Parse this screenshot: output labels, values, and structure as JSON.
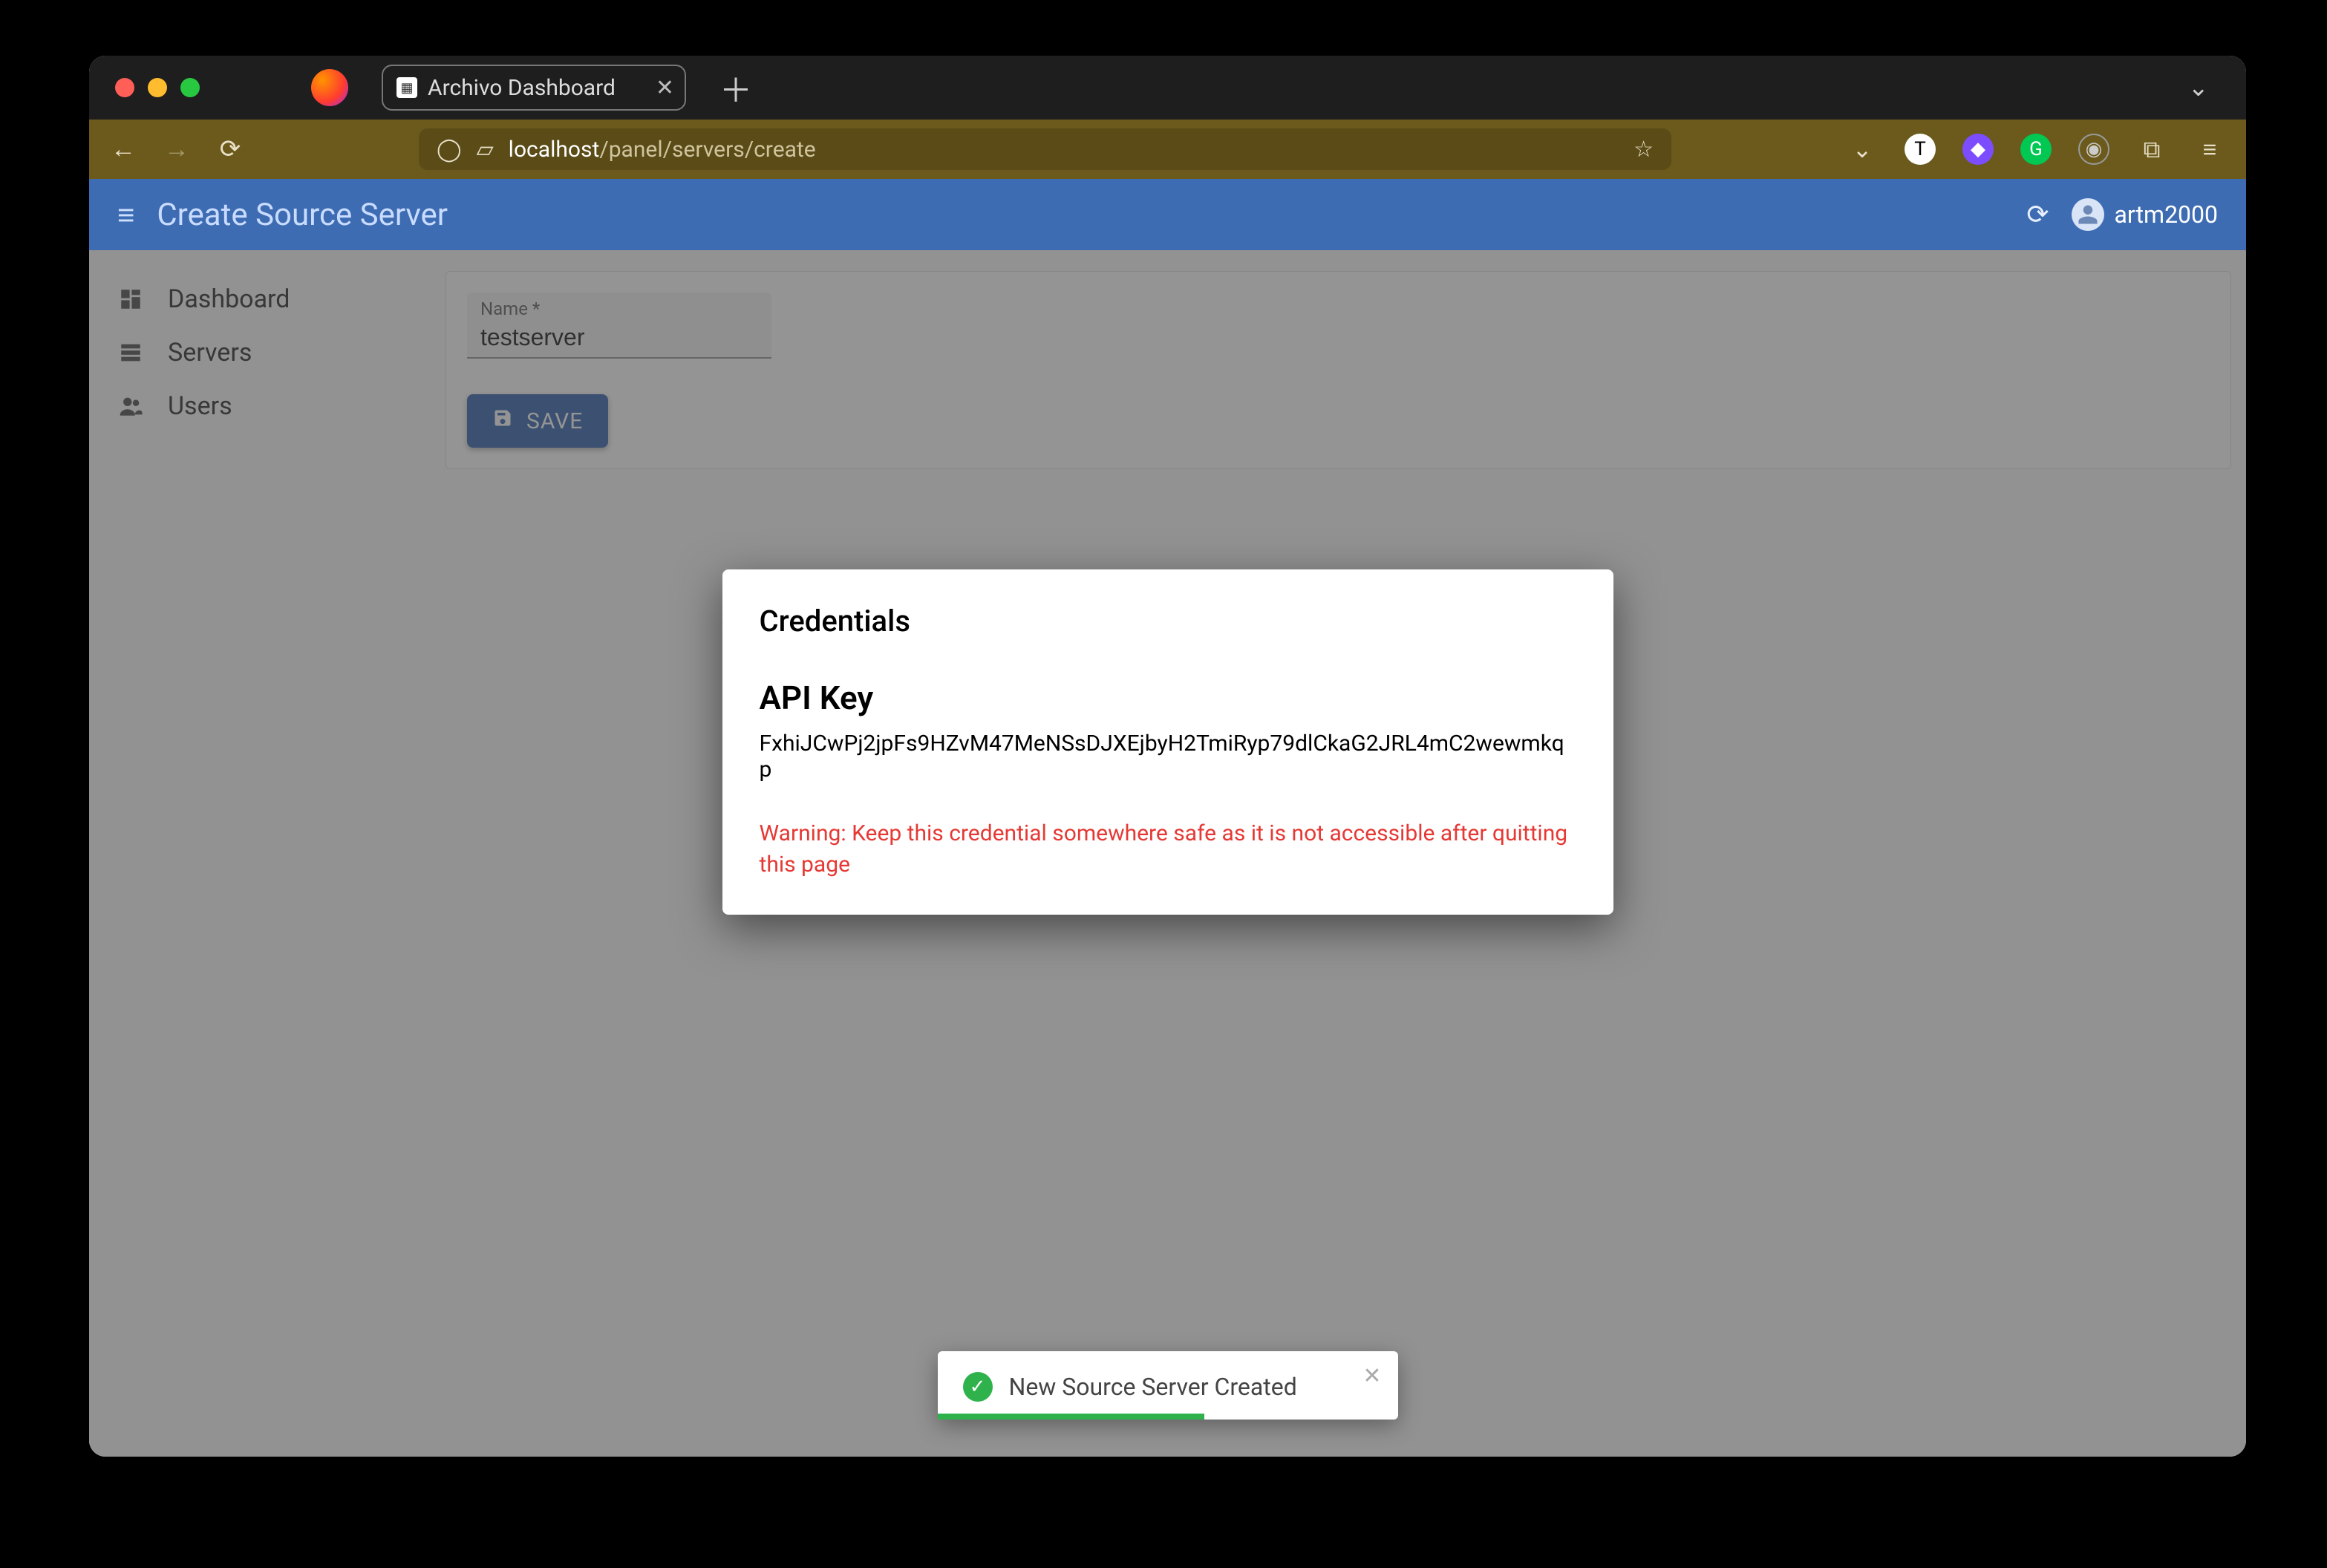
{
  "browser": {
    "tab_title": "Archivo Dashboard",
    "url_host": "localhost",
    "url_path": "/panel/servers/create"
  },
  "header": {
    "title": "Create Source Server",
    "username": "artm2000"
  },
  "sidebar": {
    "items": [
      {
        "label": "Dashboard"
      },
      {
        "label": "Servers"
      },
      {
        "label": "Users"
      }
    ]
  },
  "form": {
    "name_label": "Name *",
    "name_value": "testserver",
    "save_label": "SAVE"
  },
  "dialog": {
    "title": "Credentials",
    "subtitle": "API Key",
    "api_key": "FxhiJCwPj2jpFs9HZvM47MeNSsDJXEjbyH2TmiRyp79dlCkaG2JRL4mC2wewmkqp",
    "warning": "Warning: Keep this credential somewhere safe as it is not accessible after quitting this page"
  },
  "toast": {
    "message": "New Source Server Created"
  }
}
